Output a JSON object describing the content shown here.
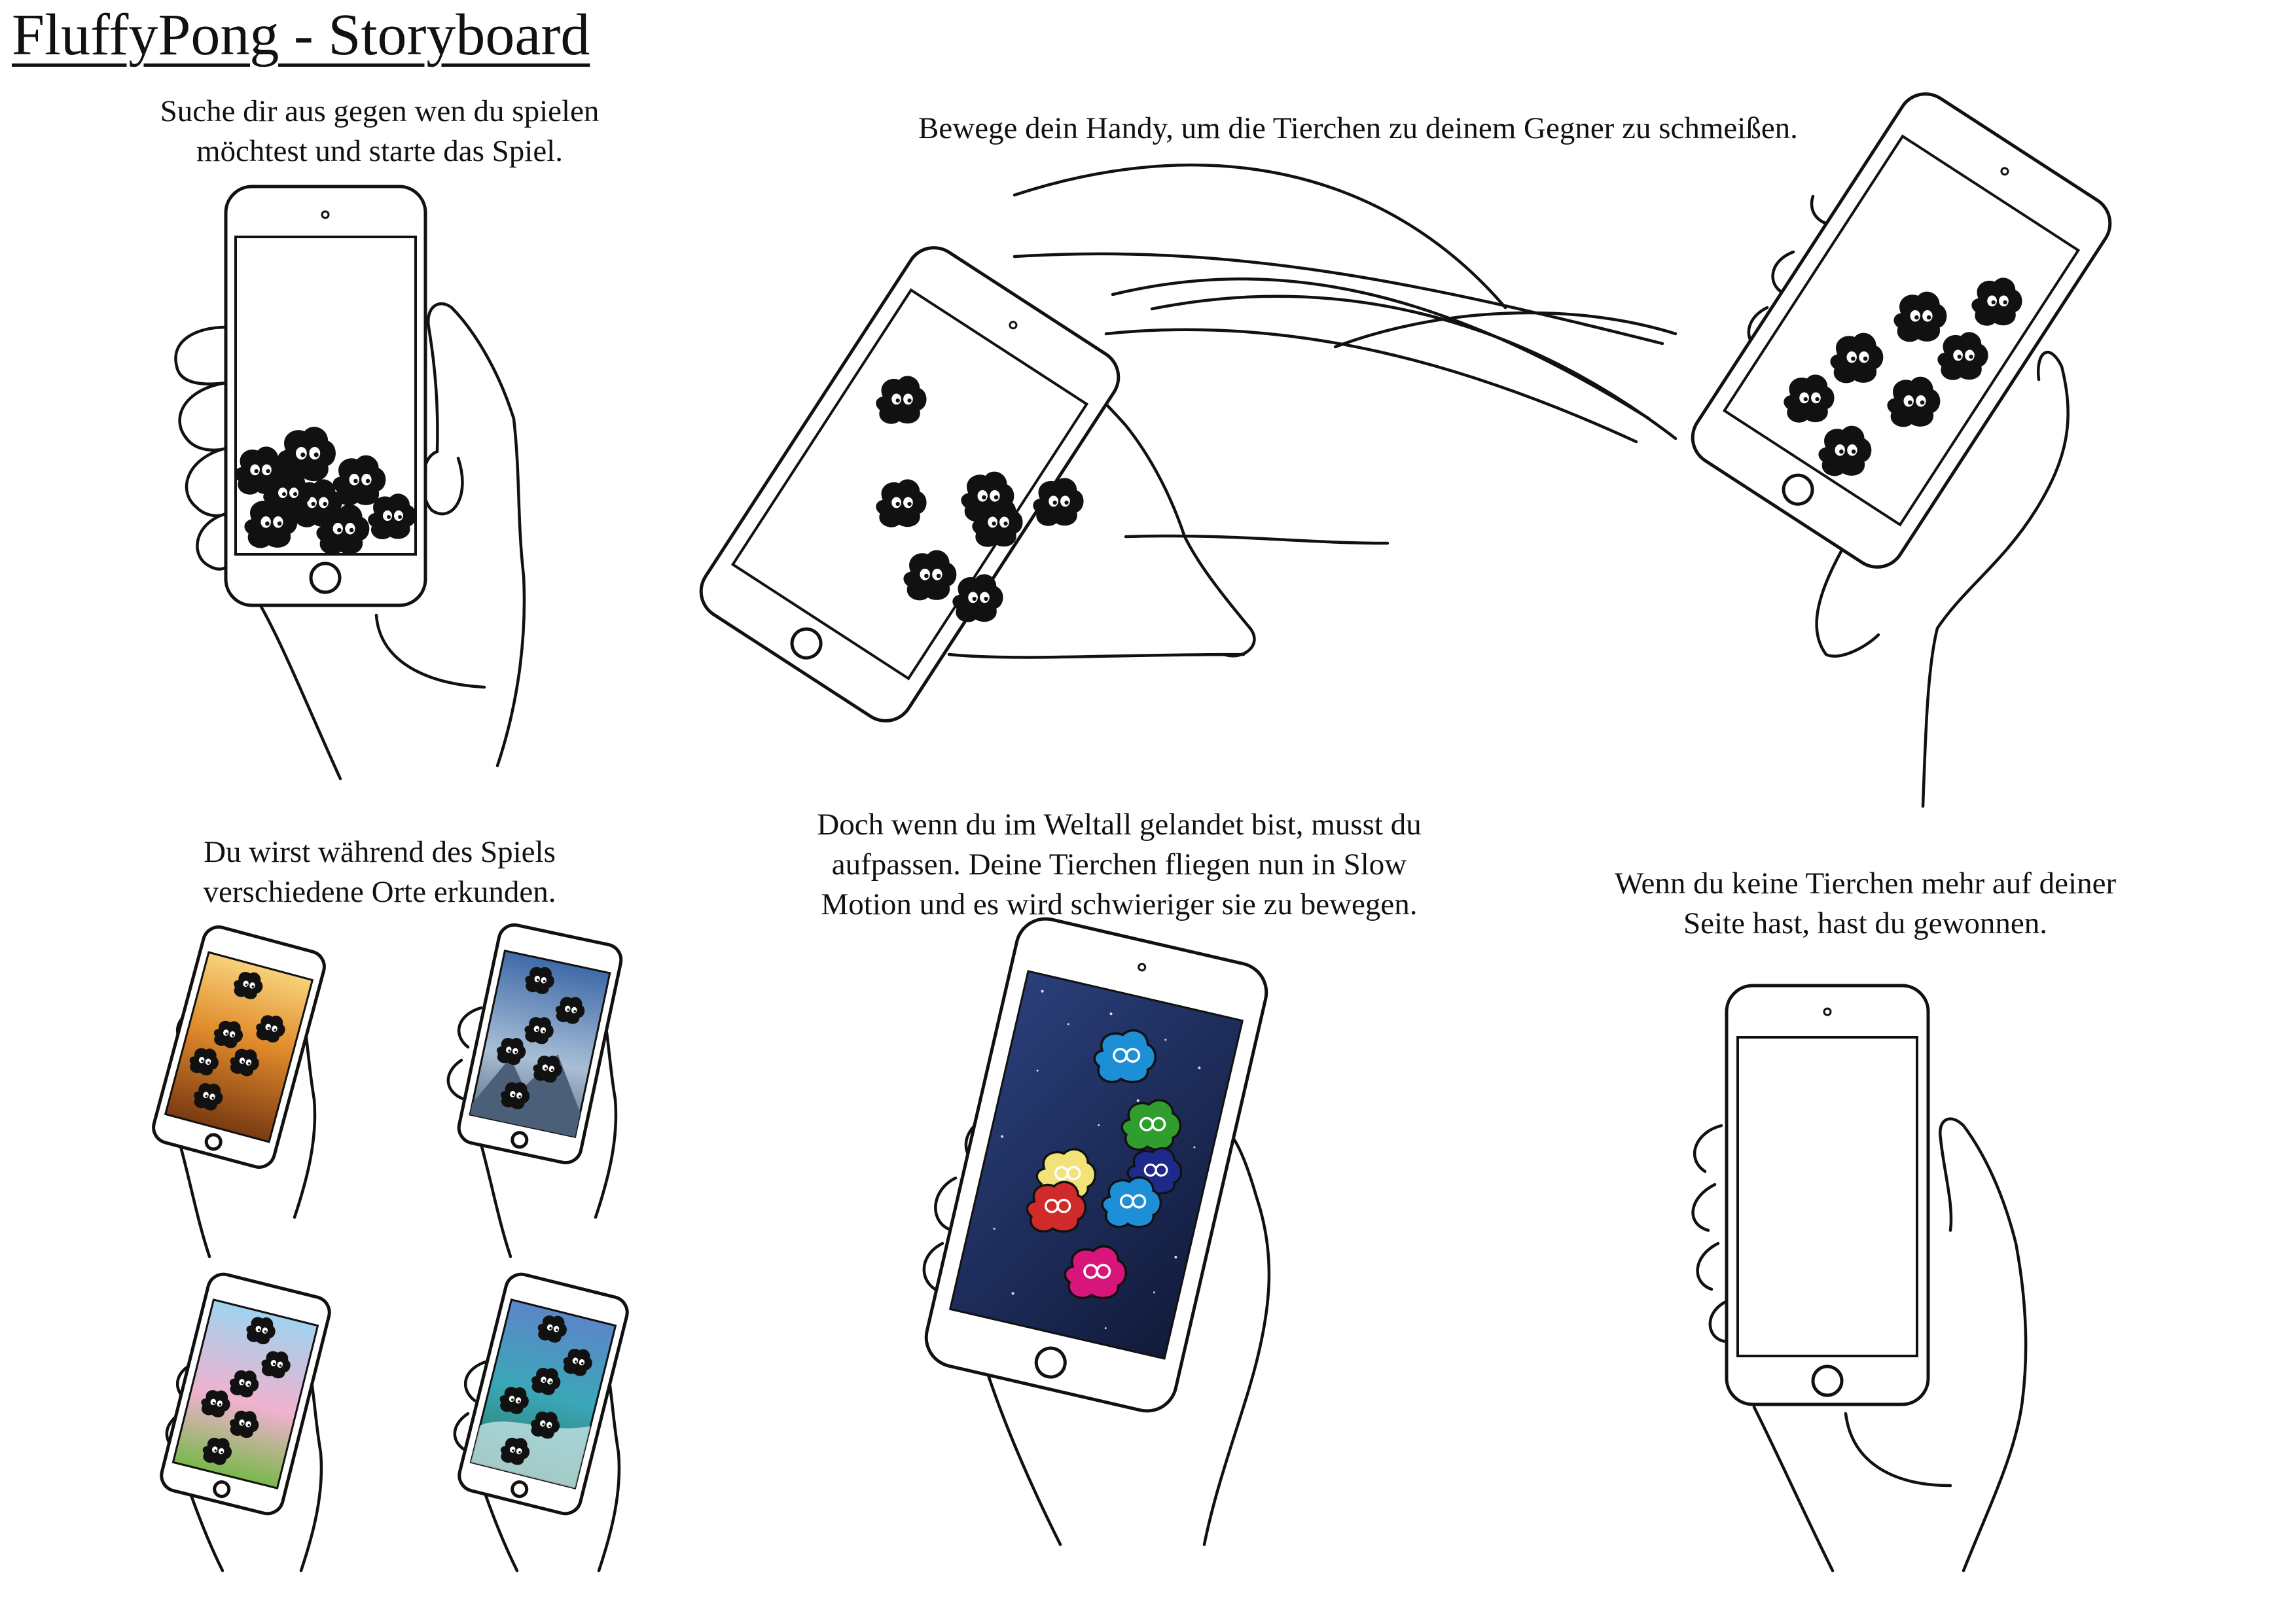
{
  "title": "FluffyPong - Storyboard",
  "panels": {
    "choose": [
      "Suche dir aus gegen wen du spielen",
      "möchtest und starte das Spiel."
    ],
    "move": "Bewege dein Handy, um die Tierchen zu deinem Gegner zu schmeißen.",
    "places": [
      "Du wirst während des Spiels",
      "verschiedene Orte erkunden."
    ],
    "space": [
      "Doch wenn du im Weltall gelandet bist, musst du",
      "aufpassen. Deine Tierchen fliegen nun in Slow",
      "Motion und es wird schwieriger sie zu bewegen."
    ],
    "win": [
      "Wenn du keine Tierchen mehr auf deiner",
      "Seite hast, hast du gewonnen."
    ]
  },
  "icons": [
    "hand-icon",
    "phone-icon",
    "fluffy-creature-icon",
    "motion-lines-icon"
  ],
  "colors": {
    "ink": "#111111",
    "space_bg": "#1b2a5a",
    "sunset": "#e08a2a",
    "mountains": "#6f8fb8",
    "meadow": "#e6a7c6",
    "beach": "#3aa7b8",
    "creature_blue": "#1d8fd6",
    "creature_green": "#2f9e2f",
    "creature_yellow": "#f2e27a",
    "creature_red": "#d12a2a",
    "creature_navy": "#1d2a8a",
    "creature_magenta": "#d8157a"
  }
}
